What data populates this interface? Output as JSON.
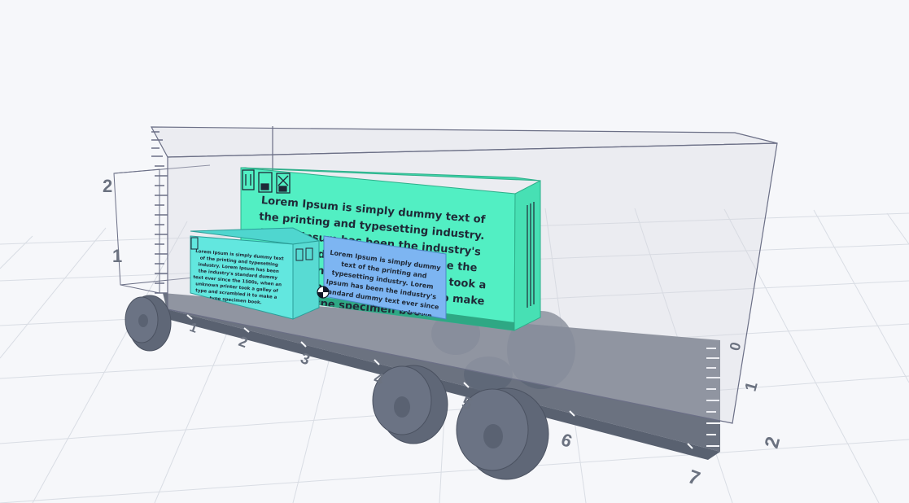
{
  "scene": {
    "background_color": "#f6f7fa",
    "grid_color": "#d9dde4",
    "truck_color": "#6b7280",
    "container_outline_color": "#6b6f86"
  },
  "height_axis": {
    "ticks": [
      {
        "label": "2"
      },
      {
        "label": "1"
      }
    ]
  },
  "length_axis": {
    "ticks": [
      {
        "label": "1"
      },
      {
        "label": "2"
      },
      {
        "label": "3"
      },
      {
        "label": "4"
      },
      {
        "label": "5"
      },
      {
        "label": "6"
      },
      {
        "label": "7"
      }
    ]
  },
  "width_axis": {
    "ticks": [
      {
        "label": "0"
      },
      {
        "label": "1"
      },
      {
        "label": "2"
      }
    ]
  },
  "cargo": {
    "large_box": {
      "color": "#52efc3",
      "text": "Lorem Ipsum is simply dummy text of the printing and typesetting industry. Lorem Ipsum has been the industry's standard dummy text ever since the 1500s, when an unknown printer took a galley of type and scrambled it to make a type specimen book.",
      "icons": [
        "this-side-up-icon",
        "keep-dry-icon",
        "fragile-icon"
      ]
    },
    "medium_box": {
      "color": "#7db5f2",
      "text": "Lorem Ipsum is simply dummy text of the printing and typesetting industry. Lorem Ipsum has been the industry's standard dummy text ever since the 1500s, when an unknown printer took a galley of type and scrambled it to make a type specimen book."
    },
    "small_box": {
      "color": "#62e7df",
      "text": "Lorem Ipsum is simply dummy text of the printing and typesetting industry. Lorem Ipsum has been the industry's standard dummy text ever since the 1500s, when an unknown printer took a galley of type and scrambled it to make a type specimen book.",
      "icons": [
        "this-side-up-icon",
        "keep-dry-icon",
        "fragile-icon"
      ]
    }
  }
}
